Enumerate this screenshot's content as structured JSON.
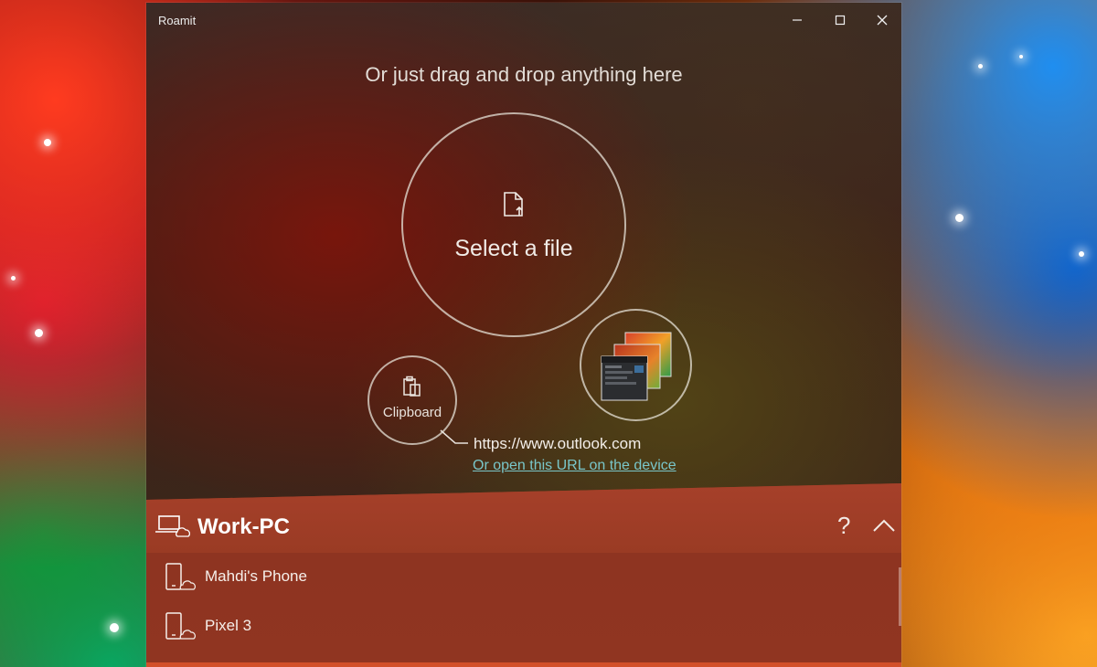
{
  "window": {
    "title": "Roamit"
  },
  "drop_area": {
    "hint": "Or just drag and drop anything here",
    "select_file_label": "Select a file",
    "clipboard_label": "Clipboard",
    "clipboard_url": "https://www.outlook.com",
    "open_url_link": "Or open this URL on the device"
  },
  "devices": {
    "current_device": "Work-PC",
    "help_label": "?",
    "list": [
      {
        "label": "Mahdi's Phone"
      },
      {
        "label": "Pixel 3"
      }
    ]
  },
  "colors": {
    "accent_panel": "#9b3a22",
    "link": "#79c6c9"
  },
  "icons": [
    "file-upload-icon",
    "clipboard-icon",
    "laptop-cloud-icon",
    "help-icon",
    "chevron-up-icon",
    "phone-cloud-icon",
    "minimize-icon",
    "maximize-icon",
    "close-icon"
  ]
}
